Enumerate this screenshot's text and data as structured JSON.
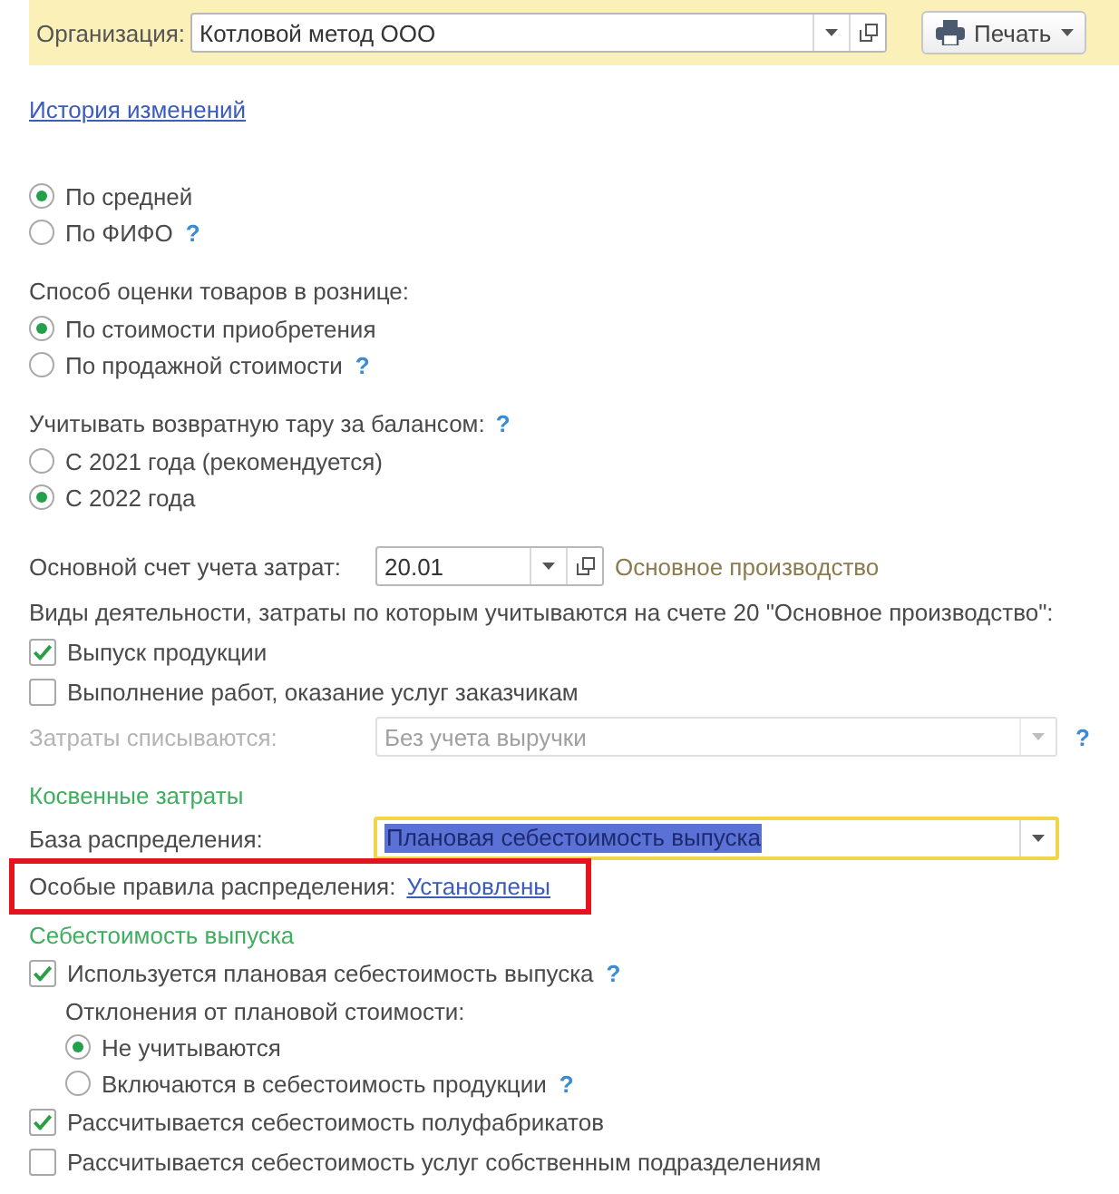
{
  "toolbar": {
    "organization": {
      "label": "Организация:",
      "value": "Котловой метод ООО",
      "open_button": true
    },
    "print_button": "Печать"
  },
  "history_link": "История изменений",
  "groups": [
    {
      "rows": [
        {
          "kind": "radio",
          "label": "По средней",
          "selected": true
        },
        {
          "kind": "radio",
          "label": "По ФИФО",
          "selected": false,
          "help": "?"
        }
      ]
    },
    {
      "rows": [
        {
          "kind": "label",
          "text": "Способ оценки товаров в рознице:"
        },
        {
          "kind": "radio",
          "label": "По стоимости приобретения",
          "selected": true
        },
        {
          "kind": "radio",
          "label": "По продажной стоимости",
          "selected": false,
          "help": "?"
        }
      ]
    },
    {
      "rows": [
        {
          "kind": "label",
          "text": "Учитывать возвратную тару за балансом:",
          "help": "?"
        },
        {
          "kind": "radio",
          "label": "С 2021 года (рекомендуется)",
          "selected": false
        },
        {
          "kind": "radio",
          "label": "С 2022 года",
          "selected": true
        }
      ]
    },
    {
      "rows": [
        {
          "kind": "field",
          "label": "Основной счет учета затрат:",
          "value": "20.01",
          "open_button": true,
          "note": "Основное производство",
          "disabled": false,
          "focused": false
        },
        {
          "kind": "label",
          "text": "Виды деятельности, затраты по которым учитываются на счете 20 \"Основное производство\":"
        },
        {
          "kind": "checkbox",
          "label": "Выпуск продукции",
          "checked": true
        },
        {
          "kind": "checkbox",
          "label": "Выполнение работ, оказание услуг заказчикам",
          "checked": false
        },
        {
          "kind": "field",
          "label": "Затраты списываются:",
          "value": "Без учета выручки",
          "open_button": false,
          "disabled": true,
          "focused": false,
          "help": "?"
        }
      ]
    },
    {
      "rows": [
        {
          "kind": "heading",
          "text": "Косвенные затраты"
        },
        {
          "kind": "field",
          "label": "База распределения:",
          "value": "Плановая себестоимость выпуска",
          "open_button": false,
          "disabled": false,
          "focused": true
        },
        {
          "kind": "link_row",
          "label": "Особые правила распределения:",
          "link": "Установлены",
          "highlighted": true
        }
      ]
    },
    {
      "rows": [
        {
          "kind": "heading",
          "text": "Себестоимость выпуска"
        },
        {
          "kind": "checkbox",
          "label": "Используется плановая себестоимость выпуска",
          "checked": true,
          "help": "?",
          "children": [
            {
              "kind": "label",
              "text": "Отклонения от плановой стоимости:"
            },
            {
              "kind": "radio",
              "label": "Не учитываются",
              "selected": true
            },
            {
              "kind": "radio",
              "label": "Включаются в себестоимость продукции",
              "selected": false,
              "help": "?"
            }
          ]
        },
        {
          "kind": "checkbox",
          "label": "Рассчитывается себестоимость полуфабрикатов",
          "checked": true
        },
        {
          "kind": "checkbox",
          "label": "Рассчитывается себестоимость услуг собственным подразделениям",
          "checked": false
        }
      ]
    }
  ]
}
